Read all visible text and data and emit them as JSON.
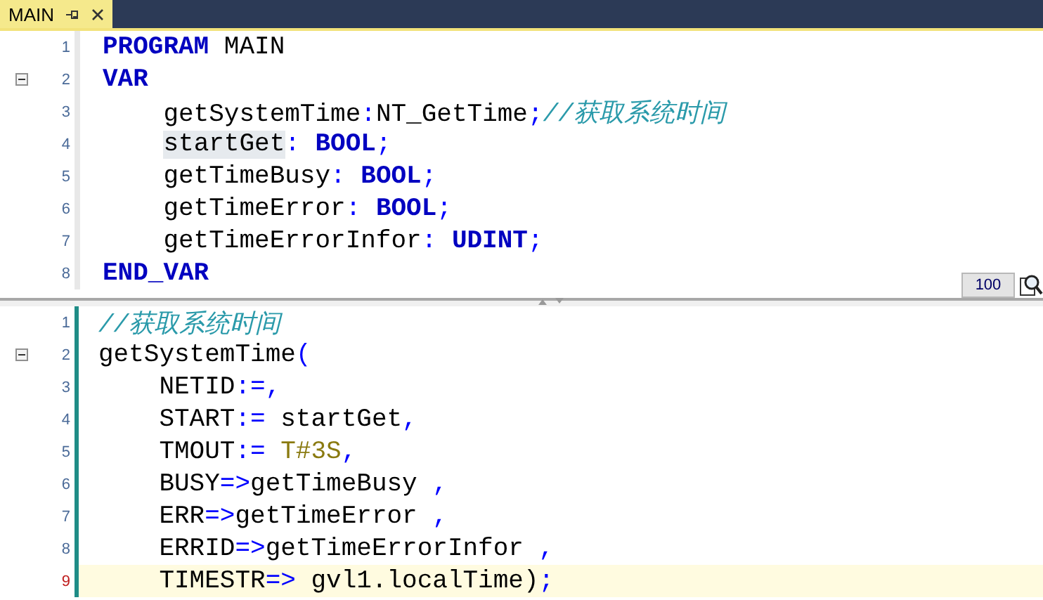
{
  "tab": {
    "title": "MAIN",
    "selected": true
  },
  "declaration_pane": {
    "lines": [
      {
        "number": "1",
        "fold_marker": false,
        "current": false,
        "tokens": [
          {
            "kind": "keyword",
            "text": "PROGRAM"
          },
          {
            "kind": "text",
            "text": " MAIN"
          }
        ]
      },
      {
        "number": "2",
        "fold_marker": true,
        "current": false,
        "tokens": [
          {
            "kind": "keyword",
            "text": "VAR"
          }
        ]
      },
      {
        "number": "3",
        "fold_marker": false,
        "current": false,
        "tokens": [
          {
            "kind": "text",
            "text": "    getSystemTime"
          },
          {
            "kind": "op",
            "text": ":"
          },
          {
            "kind": "text",
            "text": "NT_GetTime"
          },
          {
            "kind": "op",
            "text": ";"
          },
          {
            "kind": "comment",
            "text": "//获取系统时间"
          }
        ]
      },
      {
        "number": "4",
        "fold_marker": false,
        "current": false,
        "tokens": [
          {
            "kind": "highlight",
            "text": "startGet"
          },
          {
            "kind": "op",
            "text": ": "
          },
          {
            "kind": "keyword",
            "text": "BOOL"
          },
          {
            "kind": "op",
            "text": ";"
          }
        ]
      },
      {
        "number": "5",
        "fold_marker": false,
        "current": false,
        "tokens": [
          {
            "kind": "text",
            "text": "    getTimeBusy"
          },
          {
            "kind": "op",
            "text": ": "
          },
          {
            "kind": "keyword",
            "text": "BOOL"
          },
          {
            "kind": "op",
            "text": ";"
          }
        ]
      },
      {
        "number": "6",
        "fold_marker": false,
        "current": false,
        "tokens": [
          {
            "kind": "text",
            "text": "    getTimeError"
          },
          {
            "kind": "op",
            "text": ": "
          },
          {
            "kind": "keyword",
            "text": "BOOL"
          },
          {
            "kind": "op",
            "text": ";"
          }
        ]
      },
      {
        "number": "7",
        "fold_marker": false,
        "current": false,
        "tokens": [
          {
            "kind": "text",
            "text": "    getTimeErrorInfor"
          },
          {
            "kind": "op",
            "text": ": "
          },
          {
            "kind": "keyword",
            "text": "UDINT"
          },
          {
            "kind": "op",
            "text": ";"
          }
        ]
      },
      {
        "number": "8",
        "fold_marker": false,
        "current": false,
        "tokens": [
          {
            "kind": "keyword",
            "text": "END_VAR"
          }
        ]
      }
    ]
  },
  "zoom": {
    "value": "100"
  },
  "implementation_pane": {
    "lines": [
      {
        "number": "1",
        "fold_marker": false,
        "current": false,
        "tokens": [
          {
            "kind": "comment",
            "text": "//获取系统时间"
          }
        ]
      },
      {
        "number": "2",
        "fold_marker": true,
        "current": false,
        "tokens": [
          {
            "kind": "text",
            "text": "getSystemTime"
          },
          {
            "kind": "op",
            "text": "("
          }
        ]
      },
      {
        "number": "3",
        "fold_marker": false,
        "current": false,
        "tokens": [
          {
            "kind": "text",
            "text": "    NETID"
          },
          {
            "kind": "op",
            "text": ":=,"
          }
        ]
      },
      {
        "number": "4",
        "fold_marker": false,
        "current": false,
        "tokens": [
          {
            "kind": "text",
            "text": "    START"
          },
          {
            "kind": "op",
            "text": ":="
          },
          {
            "kind": "text",
            "text": " startGet"
          },
          {
            "kind": "op",
            "text": ","
          }
        ]
      },
      {
        "number": "5",
        "fold_marker": false,
        "current": false,
        "tokens": [
          {
            "kind": "text",
            "text": "    TMOUT"
          },
          {
            "kind": "op",
            "text": ":= "
          },
          {
            "kind": "literal",
            "text": "T#3S"
          },
          {
            "kind": "op",
            "text": ","
          }
        ]
      },
      {
        "number": "6",
        "fold_marker": false,
        "current": false,
        "tokens": [
          {
            "kind": "text",
            "text": "    BUSY"
          },
          {
            "kind": "op",
            "text": "=>"
          },
          {
            "kind": "text",
            "text": "getTimeBusy "
          },
          {
            "kind": "op",
            "text": ","
          }
        ]
      },
      {
        "number": "7",
        "fold_marker": false,
        "current": false,
        "tokens": [
          {
            "kind": "text",
            "text": "    ERR"
          },
          {
            "kind": "op",
            "text": "=>"
          },
          {
            "kind": "text",
            "text": "getTimeError "
          },
          {
            "kind": "op",
            "text": ","
          }
        ]
      },
      {
        "number": "8",
        "fold_marker": false,
        "current": false,
        "tokens": [
          {
            "kind": "text",
            "text": "    ERRID"
          },
          {
            "kind": "op",
            "text": "=>"
          },
          {
            "kind": "text",
            "text": "getTimeErrorInfor "
          },
          {
            "kind": "op",
            "text": ","
          }
        ]
      },
      {
        "number": "9",
        "fold_marker": false,
        "current": true,
        "tokens": [
          {
            "kind": "text",
            "text": "    TIMESTR"
          },
          {
            "kind": "op",
            "text": "=> "
          },
          {
            "kind": "text",
            "text": "gvl1.localTime)"
          },
          {
            "kind": "op",
            "text": ";"
          }
        ]
      }
    ]
  }
}
